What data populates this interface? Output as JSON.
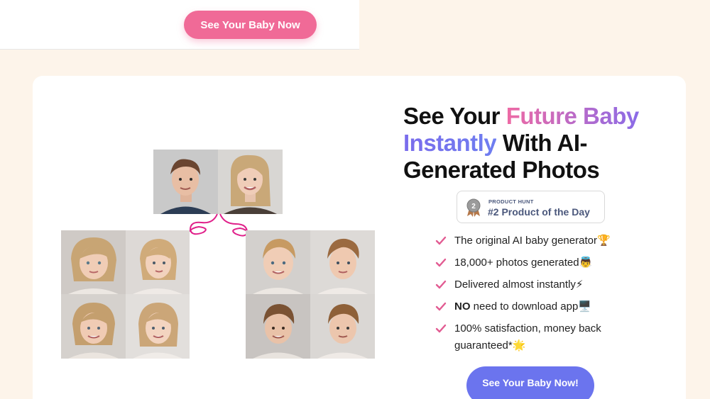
{
  "header": {
    "cta_label": "See Your Baby Now"
  },
  "hero": {
    "headline_part1": "See Your ",
    "headline_highlight1": "Future Baby",
    "headline_highlight2": "Instantly",
    "headline_part2": " With AI-Generated Photos",
    "badge": {
      "small_label": "PRODUCT HUNT",
      "big_label": "#2 Product of the Day",
      "medal_number": "2"
    },
    "features": [
      {
        "prefix": "",
        "text": "The original AI baby generator🏆"
      },
      {
        "prefix": "",
        "text": "18,000+ photos generated👼"
      },
      {
        "prefix": "",
        "text": "Delivered almost instantly⚡"
      },
      {
        "prefix": "NO",
        "text": " need to download app🖥️"
      },
      {
        "prefix": "",
        "text": "100% satisfaction, money back guaranteed*🌟"
      }
    ],
    "cta_label": "See Your Baby Now!"
  },
  "images": {
    "parents": [
      "father-portrait",
      "mother-portrait"
    ],
    "daughters": [
      "girl-portrait-1",
      "girl-portrait-2",
      "girl-portrait-3",
      "girl-portrait-4"
    ],
    "sons": [
      "boy-portrait-1",
      "boy-portrait-2",
      "boy-portrait-3",
      "boy-portrait-4"
    ]
  },
  "colors": {
    "page_bg": "#fdf4ea",
    "pink": "#f06a97",
    "violet": "#6b74ee",
    "check": "#e25b92",
    "arrow": "#e0208a"
  }
}
